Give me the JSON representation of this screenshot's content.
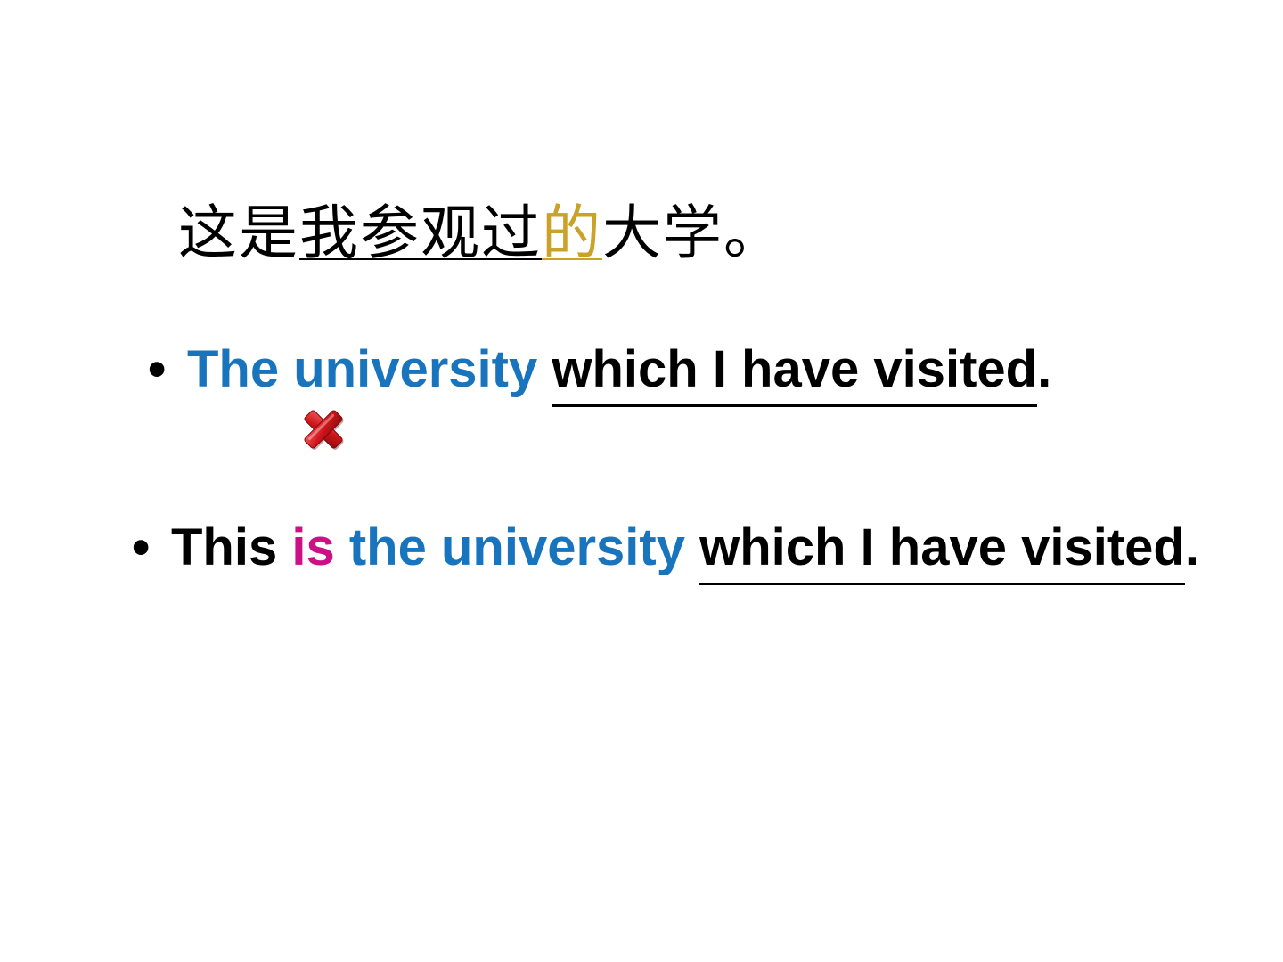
{
  "chinese_sentence": {
    "part_plain_start": "这是",
    "part_underlined": "我参观过",
    "part_highlight": "的",
    "part_plain_end": "大学。"
  },
  "sentence1": {
    "bullet": "•",
    "subject": "The university",
    "clause": "which I have visited",
    "end": "."
  },
  "wrong_icon": "red-x-icon",
  "sentence2": {
    "bullet": "•",
    "this": "This",
    "is": "is",
    "subject": "the university",
    "clause": "which I have visited",
    "end": "."
  },
  "colors": {
    "blue": "#1874bc",
    "magenta": "#cc1086",
    "gold": "#c9a227",
    "error_red": "#d0161b"
  }
}
